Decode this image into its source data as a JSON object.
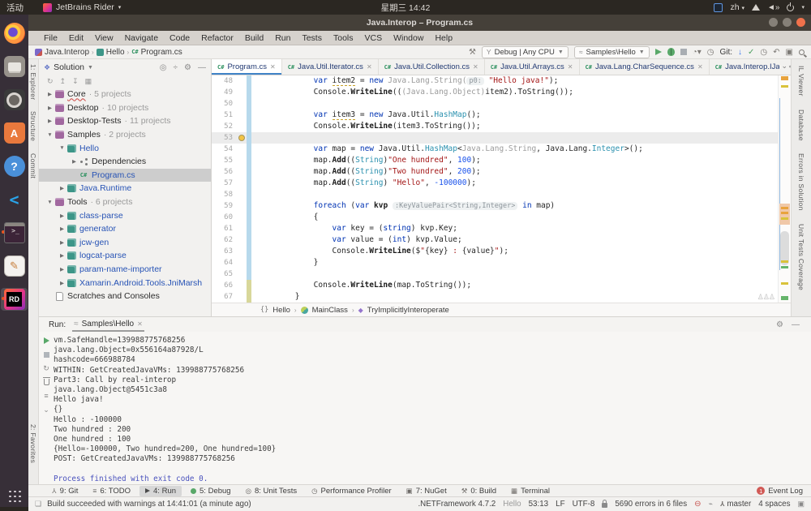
{
  "os_bar": {
    "activities": "活动",
    "app_name": "JetBrains Rider",
    "clock": "星期三 14:42",
    "layout": "zh"
  },
  "window": {
    "title": "Java.Interop – Program.cs"
  },
  "menu": {
    "items": [
      "File",
      "Edit",
      "View",
      "Navigate",
      "Code",
      "Refactor",
      "Build",
      "Run",
      "Tests",
      "Tools",
      "VCS",
      "Window",
      "Help"
    ]
  },
  "toolbar": {
    "breadcrumbs": [
      "Java.Interop",
      "Hello",
      "Program.cs"
    ],
    "config_selector": "Debug | Any CPU",
    "run_target": "Samples\\Hello",
    "git_label": "Git:"
  },
  "dock": {
    "items": [
      {
        "name": "firefox"
      },
      {
        "name": "files"
      },
      {
        "name": "music"
      },
      {
        "name": "software"
      },
      {
        "name": "help"
      },
      {
        "name": "vscode"
      },
      {
        "name": "terminal",
        "running": true
      },
      {
        "name": "editor"
      },
      {
        "name": "rider",
        "running": true,
        "active": true
      }
    ]
  },
  "left_stripe": {
    "items": [
      "1: Explorer",
      "Structure",
      "Commit"
    ],
    "bottom_item": "2: Favorites"
  },
  "right_stripe": {
    "items": [
      "IL Viewer",
      "Database",
      "Errors in Solution",
      "Unit Tests Coverage"
    ]
  },
  "solution": {
    "header": "Solution",
    "tree": [
      {
        "indent": 0,
        "arrow": "▶",
        "icon": "slnfolder",
        "label": "Core",
        "count": "5 projects",
        "squiggly": true
      },
      {
        "indent": 0,
        "arrow": "▶",
        "icon": "slnfolder",
        "label": "Desktop",
        "count": "10 projects"
      },
      {
        "indent": 0,
        "arrow": "▶",
        "icon": "slnfolder",
        "label": "Desktop-Tests",
        "count": "11 projects"
      },
      {
        "indent": 0,
        "arrow": "▼",
        "icon": "slnfolder",
        "label": "Samples",
        "count": "2 projects"
      },
      {
        "indent": 1,
        "arrow": "▼",
        "icon": "project",
        "label": "Hello",
        "blue": true
      },
      {
        "indent": 2,
        "arrow": "▶",
        "icon": "deps",
        "label": "Dependencies"
      },
      {
        "indent": 2,
        "arrow": "",
        "icon": "csfile",
        "label": "Program.cs",
        "blue": true,
        "selected": true
      },
      {
        "indent": 1,
        "arrow": "▶",
        "icon": "project",
        "label": "Java.Runtime",
        "blue": true
      },
      {
        "indent": 0,
        "arrow": "▼",
        "icon": "slnfolder",
        "label": "Tools",
        "count": "6 projects"
      },
      {
        "indent": 1,
        "arrow": "▶",
        "icon": "project",
        "label": "class-parse",
        "blue": true
      },
      {
        "indent": 1,
        "arrow": "▶",
        "icon": "project",
        "label": "generator",
        "blue": true
      },
      {
        "indent": 1,
        "arrow": "▶",
        "icon": "project",
        "label": "jcw-gen",
        "blue": true
      },
      {
        "indent": 1,
        "arrow": "▶",
        "icon": "project",
        "label": "logcat-parse",
        "blue": true
      },
      {
        "indent": 1,
        "arrow": "▶",
        "icon": "project",
        "label": "param-name-importer",
        "blue": true
      },
      {
        "indent": 1,
        "arrow": "▶",
        "icon": "project",
        "label": "Xamarin.Android.Tools.JniMarsh",
        "blue": true
      },
      {
        "indent": 0,
        "arrow": "",
        "icon": "scratch",
        "label": "Scratches and Consoles"
      }
    ]
  },
  "editor": {
    "tabs": [
      {
        "label": "Program.cs",
        "active": true
      },
      {
        "label": "Java.Util.Iterator.cs"
      },
      {
        "label": "Java.Util.Collection.cs"
      },
      {
        "label": "Java.Util.Arrays.cs"
      },
      {
        "label": "Java.Lang.CharSequence.cs"
      },
      {
        "label": "Java.Interop.IJav"
      }
    ],
    "breadcrumbs": [
      "Hello",
      "MainClass",
      "TryImplicitlyInteroperate"
    ],
    "lines": [
      {
        "n": 48,
        "bar": "b",
        "tokens": [
          [
            "p",
            "            "
          ],
          [
            "k",
            "var"
          ],
          [
            "p",
            " "
          ],
          [
            "w",
            "item2"
          ],
          [
            "p",
            " = "
          ],
          [
            "k",
            "new"
          ],
          [
            "p",
            " "
          ],
          [
            "d",
            "Java.Lang.String("
          ],
          [
            "h",
            "p0:"
          ],
          [
            "p",
            " "
          ],
          [
            "s",
            "\"Hello java!\""
          ],
          [
            "p",
            ");"
          ]
        ]
      },
      {
        "n": 49,
        "bar": "b",
        "tokens": [
          [
            "p",
            "            Console."
          ],
          [
            "m",
            "WriteLine"
          ],
          [
            "p",
            "(("
          ],
          [
            "d",
            "(Java.Lang.Object)"
          ],
          [
            "p",
            "item2).ToString());"
          ]
        ]
      },
      {
        "n": 50,
        "bar": "b",
        "tokens": []
      },
      {
        "n": 51,
        "bar": "b",
        "tokens": [
          [
            "p",
            "            "
          ],
          [
            "k",
            "var"
          ],
          [
            "p",
            " "
          ],
          [
            "w",
            "item3"
          ],
          [
            "p",
            " = "
          ],
          [
            "k",
            "new"
          ],
          [
            "p",
            " Java.Util."
          ],
          [
            "t",
            "HashMap"
          ],
          [
            "p",
            "();"
          ]
        ]
      },
      {
        "n": 52,
        "bar": "b",
        "tokens": [
          [
            "p",
            "            Console."
          ],
          [
            "m",
            "WriteLine"
          ],
          [
            "p",
            "(item3.ToString());"
          ]
        ]
      },
      {
        "n": 53,
        "bar": "b",
        "caret": true,
        "bulb": true,
        "tokens": []
      },
      {
        "n": 54,
        "bar": "b",
        "tokens": [
          [
            "p",
            "            "
          ],
          [
            "k",
            "var"
          ],
          [
            "p",
            " map = "
          ],
          [
            "k",
            "new"
          ],
          [
            "p",
            " Java.Util."
          ],
          [
            "t",
            "HashMap"
          ],
          [
            "p",
            "<"
          ],
          [
            "d",
            "Java.Lang.String"
          ],
          [
            "p",
            ", Java.Lang."
          ],
          [
            "t",
            "Integer"
          ],
          [
            "p",
            ">();"
          ]
        ]
      },
      {
        "n": 55,
        "bar": "b",
        "tokens": [
          [
            "p",
            "            map."
          ],
          [
            "m",
            "Add"
          ],
          [
            "p",
            "(("
          ],
          [
            "t",
            "String"
          ],
          [
            "p",
            ")"
          ],
          [
            "s",
            "\"One hundred\""
          ],
          [
            "p",
            ", "
          ],
          [
            "n2",
            "100"
          ],
          [
            "p",
            ");"
          ]
        ]
      },
      {
        "n": 56,
        "bar": "b",
        "tokens": [
          [
            "p",
            "            map."
          ],
          [
            "m",
            "Add"
          ],
          [
            "p",
            "(("
          ],
          [
            "t",
            "String"
          ],
          [
            "p",
            ")"
          ],
          [
            "s",
            "\"Two hundred\""
          ],
          [
            "p",
            ", "
          ],
          [
            "n2",
            "200"
          ],
          [
            "p",
            ");"
          ]
        ]
      },
      {
        "n": 57,
        "bar": "b",
        "tokens": [
          [
            "p",
            "            map."
          ],
          [
            "m",
            "Add"
          ],
          [
            "p",
            "(("
          ],
          [
            "t",
            "String"
          ],
          [
            "p",
            ") "
          ],
          [
            "s",
            "\"Hello\""
          ],
          [
            "p",
            ", "
          ],
          [
            "n2",
            "-100000"
          ],
          [
            "p",
            ");"
          ]
        ]
      },
      {
        "n": 58,
        "bar": "b",
        "tokens": []
      },
      {
        "n": 59,
        "bar": "b",
        "tokens": [
          [
            "p",
            "            "
          ],
          [
            "k",
            "foreach"
          ],
          [
            "p",
            " ("
          ],
          [
            "k",
            "var"
          ],
          [
            "p",
            " "
          ],
          [
            "m",
            "kvp"
          ],
          [
            "p",
            " "
          ],
          [
            "h",
            ":KeyValuePair<String,Integer>"
          ],
          [
            "p",
            " "
          ],
          [
            "k",
            "in"
          ],
          [
            "p",
            " map)"
          ]
        ]
      },
      {
        "n": 60,
        "bar": "b",
        "tokens": [
          [
            "p",
            "            {"
          ]
        ]
      },
      {
        "n": 61,
        "bar": "b",
        "tokens": [
          [
            "p",
            "                "
          ],
          [
            "k",
            "var"
          ],
          [
            "p",
            " key = ("
          ],
          [
            "k",
            "string"
          ],
          [
            "p",
            ") kvp.Key;"
          ]
        ]
      },
      {
        "n": 62,
        "bar": "b",
        "tokens": [
          [
            "p",
            "                "
          ],
          [
            "k",
            "var"
          ],
          [
            "p",
            " value = ("
          ],
          [
            "k",
            "int"
          ],
          [
            "p",
            ") kvp.Value;"
          ]
        ]
      },
      {
        "n": 63,
        "bar": "b",
        "tokens": [
          [
            "p",
            "                Console."
          ],
          [
            "m",
            "WriteLine"
          ],
          [
            "p",
            "($"
          ],
          [
            "s",
            "\""
          ],
          [
            "p",
            "{key}"
          ],
          [
            "s",
            " : "
          ],
          [
            "p",
            "{value}"
          ],
          [
            "s",
            "\""
          ],
          [
            "p",
            ");"
          ]
        ]
      },
      {
        "n": 64,
        "bar": "b",
        "tokens": [
          [
            "p",
            "            }"
          ]
        ]
      },
      {
        "n": 65,
        "bar": "b",
        "tokens": []
      },
      {
        "n": 66,
        "bar": "o",
        "tokens": [
          [
            "p",
            "            Console."
          ],
          [
            "m",
            "WriteLine"
          ],
          [
            "p",
            "(map.ToString());"
          ]
        ]
      },
      {
        "n": 67,
        "bar": "o",
        "tokens": [
          [
            "p",
            "        }"
          ]
        ]
      }
    ]
  },
  "run": {
    "label": "Run:",
    "tab": "Samples\\Hello",
    "console": [
      "vm.SafeHandle=139988775768256",
      "java.lang.Object=0x556164a87928/L",
      "hashcode=666988784",
      "WITHIN: GetCreatedJavaVMs: 139988775768256",
      "Part3: Call by real-interop",
      "java.lang.Object@5451c3a8",
      "Hello java!",
      "{}",
      "Hello : -100000",
      "Two hundred : 200",
      "One hundred : 100",
      "{Hello=-100000, Two hundred=200, One hundred=100}",
      "POST: GetCreatedJavaVMs: 139988775768256",
      "",
      {
        "t": "Process finished with exit code 0.",
        "c": "exit"
      }
    ]
  },
  "bottom_stripe": {
    "items": [
      {
        "icon": "branch",
        "label": "9: Git"
      },
      {
        "icon": "list",
        "label": "6: TODO"
      },
      {
        "icon": "play",
        "label": "4: Run",
        "active": true
      },
      {
        "icon": "bug",
        "label": "5: Debug"
      },
      {
        "icon": "tests",
        "label": "8: Unit Tests"
      },
      {
        "icon": "clock",
        "label": "Performance Profiler"
      },
      {
        "icon": "pkg",
        "label": "7: NuGet"
      },
      {
        "icon": "hammer",
        "label": "0: Build"
      },
      {
        "icon": "term",
        "label": "Terminal"
      }
    ],
    "event_log": {
      "label": "Event Log",
      "badge": "1"
    }
  },
  "status": {
    "message": "Build succeeded with warnings at 14:41:01 (a minute ago)",
    "framework": ".NETFramework 4.7.2",
    "config": "Hello",
    "caret": "53:13",
    "line_sep": "LF",
    "encoding": "UTF-8",
    "errors": "5690 errors in 6 files",
    "branch": "master",
    "indent": "4 spaces"
  },
  "colors": {
    "accent_blue": "#3574f0",
    "change_bar": "#b7d9ec",
    "change_bar_olive": "#d8d79a",
    "close_button": "#f0714b",
    "run_green": "#59a869"
  }
}
